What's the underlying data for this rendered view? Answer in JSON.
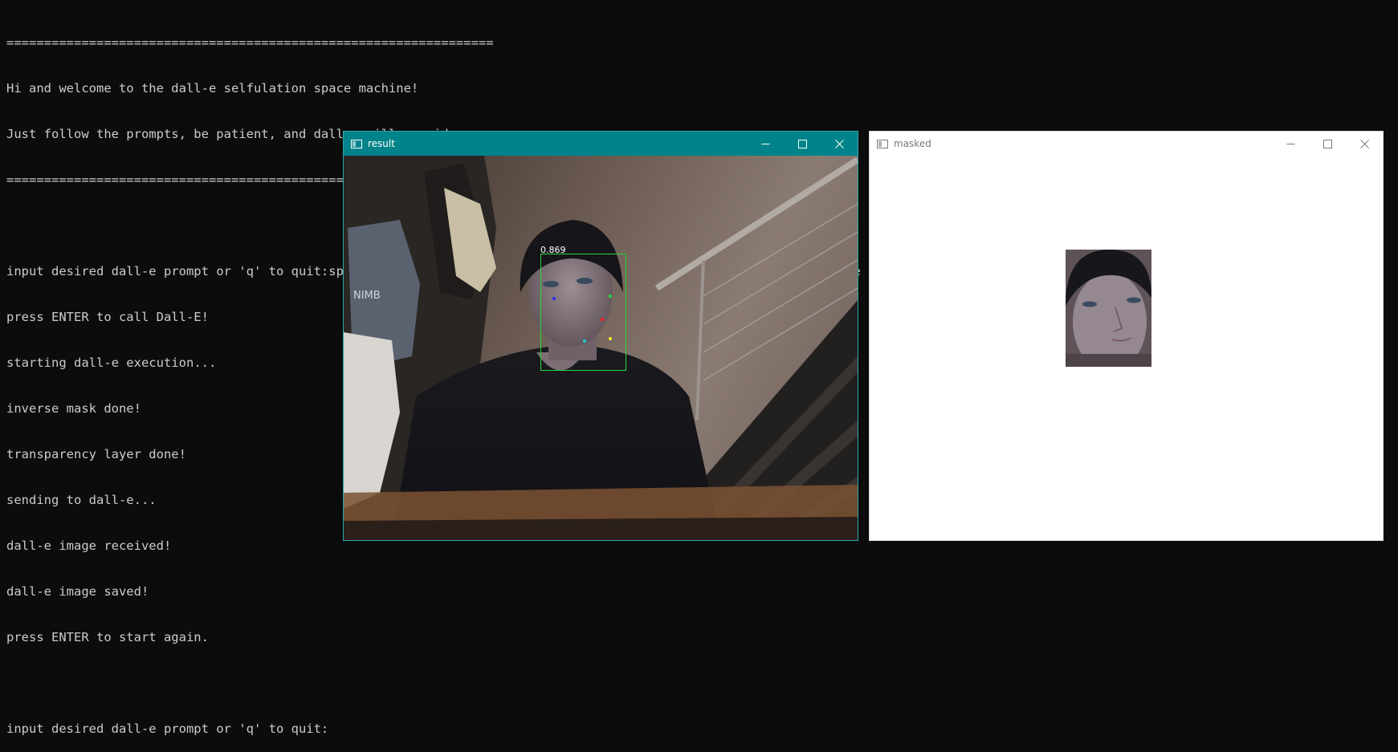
{
  "console": {
    "lines": [
      "=================================================================",
      "Hi and welcome to the dall-e selfulation space machine!",
      "Just follow the prompts, be patient, and dall-e will provide...",
      "=================================================================",
      "",
      "input desired dall-e prompt or 'q' to quit:spaceman floating in space against the intergalactic plane of existence",
      "press ENTER to call Dall-E!",
      "starting dall-e execution...",
      "inverse mask done!",
      "transparency layer done!",
      "sending to dall-e...",
      "dall-e image received!",
      "dall-e image saved!",
      "press ENTER to start again.",
      "",
      "input desired dall-e prompt or 'q' to quit:"
    ]
  },
  "result_window": {
    "title": "result",
    "confidence": "0.869",
    "titlebar_color": "#00838a",
    "box_color": "#27d63a",
    "landmarks": [
      {
        "name": "left-eye",
        "color": "#2a2aff"
      },
      {
        "name": "right-eye",
        "color": "#27d63a"
      },
      {
        "name": "nose",
        "color": "#ff2020"
      },
      {
        "name": "mouth-left",
        "color": "#22d0d0"
      },
      {
        "name": "mouth-right",
        "color": "#ffee22"
      }
    ]
  },
  "masked_window": {
    "title": "masked"
  },
  "window_controls": {
    "minimize": "minimize-icon",
    "maximize": "maximize-icon",
    "close": "close-icon"
  }
}
